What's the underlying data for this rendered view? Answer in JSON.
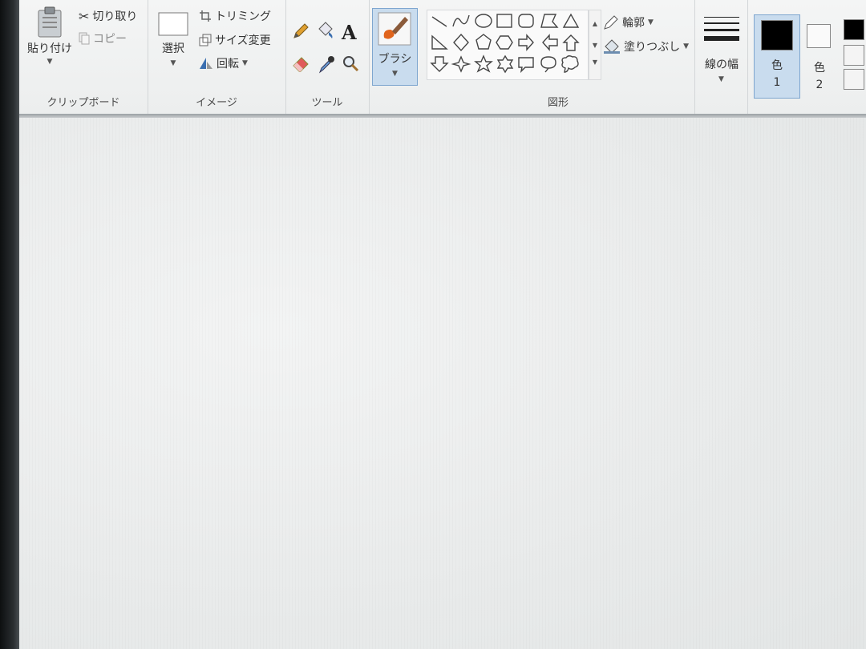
{
  "clipboard": {
    "paste_label": "貼り付け",
    "cut_label": "切り取り",
    "copy_label": "コピー",
    "group_label": "クリップボード"
  },
  "image": {
    "select_label": "選択",
    "crop_label": "トリミング",
    "resize_label": "サイズ変更",
    "rotate_label": "回転",
    "group_label": "イメージ"
  },
  "tools": {
    "text_tool_glyph": "A",
    "group_label": "ツール"
  },
  "brush": {
    "label": "ブラシ"
  },
  "shapes": {
    "outline_label": "輪郭",
    "fill_label": "塗りつぶし",
    "group_label": "図形",
    "items": [
      "line",
      "curve",
      "oval",
      "rectangle",
      "rounded-rectangle",
      "polygon",
      "triangle",
      "right-triangle",
      "diamond",
      "pentagon",
      "hexagon",
      "right-arrow",
      "left-arrow",
      "up-arrow",
      "down-arrow",
      "four-point-star",
      "five-point-star",
      "six-point-star",
      "rectangular-callout",
      "oval-callout",
      "cloud-callout"
    ]
  },
  "size": {
    "label": "線の幅"
  },
  "colors": {
    "color1_label": "色",
    "color1_num": "1",
    "color2_label": "色",
    "color2_num": "2",
    "color1_value": "#000000",
    "color2_value": "#ffffff",
    "accent": "#c9dcee"
  }
}
